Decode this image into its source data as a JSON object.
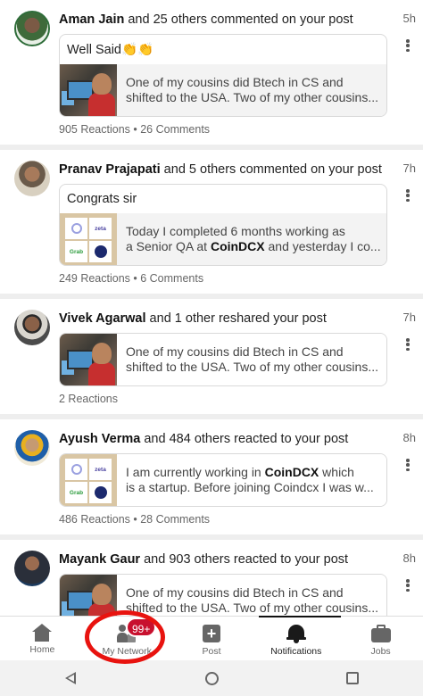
{
  "notifications": [
    {
      "actor": "Aman Jain",
      "action": " and 25 others commented on your post",
      "time": "5h",
      "comment": "Well Said👏👏",
      "thumb": "photo",
      "snippet_line1": "One of my cousins did Btech in CS and",
      "snippet_line2": "shifted to the USA. Two of my other cousins...",
      "stats": "905 Reactions • 26 Comments"
    },
    {
      "actor": "Pranav Prajapati",
      "action": " and 5 others commented on your post",
      "time": "7h",
      "comment": "Congrats sir",
      "thumb": "logos",
      "snippet_line1": "Today I completed 6 months working as",
      "snippet_line2_pre": "a Senior QA at ",
      "snippet_line2_bold": "CoinDCX",
      "snippet_line2_post": " and yesterday I co...",
      "stats": "249 Reactions • 6 Comments"
    },
    {
      "actor": "Vivek Agarwal",
      "action": " and 1 other reshared your post",
      "time": "7h",
      "thumb": "photo",
      "snippet_line1": "One of my cousins did Btech in CS and",
      "snippet_line2": "shifted to the USA. Two of my other cousins...",
      "stats": "2 Reactions"
    },
    {
      "actor": "Ayush Verma",
      "action": " and 484 others reacted to your post",
      "time": "8h",
      "thumb": "logos",
      "snippet_line1_pre": "I am currently working in ",
      "snippet_line1_bold": "CoinDCX",
      "snippet_line1_post": " which",
      "snippet_line2": "is a startup. Before joining Coindcx I was w...",
      "stats": "486 Reactions • 28 Comments"
    },
    {
      "actor": "Mayank Gaur",
      "action": " and 903 others reacted to your post",
      "time": "8h",
      "thumb": "photo",
      "snippet_line1": "One of my cousins did Btech in CS and",
      "snippet_line2": "shifted to the USA. Two of my other cousins..."
    }
  ],
  "thumb_logos": {
    "t1": "",
    "t2": "zeta",
    "t3": "Grab"
  },
  "nav": {
    "home": "Home",
    "network": "My Network",
    "network_badge": "99+",
    "post": "Post",
    "notifications": "Notifications",
    "jobs": "Jobs"
  },
  "colors": {
    "badge": "#c8102e",
    "highlight_ring": "#e8130f"
  }
}
